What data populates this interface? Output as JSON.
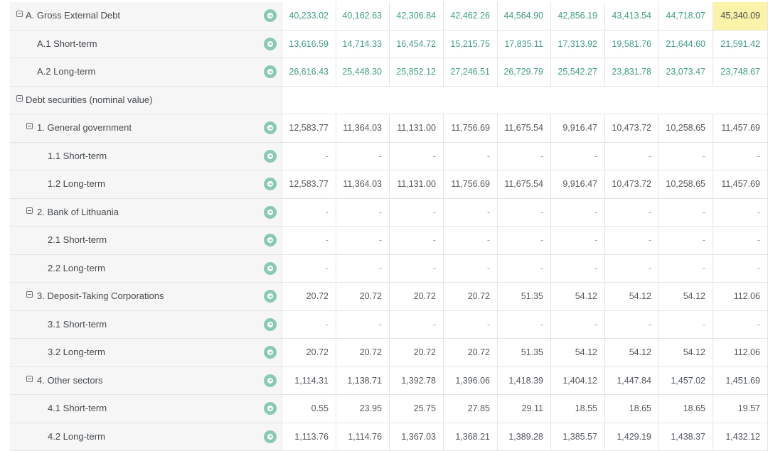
{
  "table": {
    "rows": [
      {
        "label": "A. Gross External Debt",
        "level": 0,
        "toggle": true,
        "info": true,
        "style": "green",
        "highlight_last": true,
        "values": [
          "40,233.02",
          "40,162.63",
          "42,306.84",
          "42,462.26",
          "44,564.90",
          "42,856.19",
          "43,413.54",
          "44,718.07",
          "45,340.09"
        ]
      },
      {
        "label": "A.1 Short-term",
        "level": 2,
        "toggle": false,
        "info": true,
        "style": "green",
        "values": [
          "13,616.59",
          "14,714.33",
          "16,454.72",
          "15,215.75",
          "17,835.11",
          "17,313.92",
          "19,581.76",
          "21,644.60",
          "21,591.42"
        ]
      },
      {
        "label": "A.2 Long-term",
        "level": 2,
        "toggle": false,
        "info": true,
        "style": "green",
        "values": [
          "26,616.43",
          "25,448.30",
          "25,852.12",
          "27,246.51",
          "26,729.79",
          "25,542.27",
          "23,831.78",
          "23,073.47",
          "23,748.67"
        ]
      },
      {
        "label": "Debt securities (nominal value)",
        "level": 0,
        "toggle": true,
        "info": false,
        "values": []
      },
      {
        "label": "1. General government",
        "level": 1,
        "toggle": true,
        "info": true,
        "values": [
          "12,583.77",
          "11,364.03",
          "11,131.00",
          "11,756.69",
          "11,675.54",
          "9,916.47",
          "10,473.72",
          "10,258.65",
          "11,457.69"
        ]
      },
      {
        "label": "1.1 Short-term",
        "level": 3,
        "toggle": false,
        "info": true,
        "values": [
          "-",
          "-",
          "-",
          "-",
          "-",
          "-",
          "-",
          "-",
          "-"
        ]
      },
      {
        "label": "1.2 Long-term",
        "level": 3,
        "toggle": false,
        "info": true,
        "values": [
          "12,583.77",
          "11,364.03",
          "11,131.00",
          "11,756.69",
          "11,675.54",
          "9,916.47",
          "10,473.72",
          "10,258.65",
          "11,457.69"
        ]
      },
      {
        "label": "2. Bank of Lithuania",
        "level": 1,
        "toggle": true,
        "info": true,
        "values": [
          "-",
          "-",
          "-",
          "-",
          "-",
          "-",
          "-",
          "-",
          "-"
        ]
      },
      {
        "label": "2.1 Short-term",
        "level": 3,
        "toggle": false,
        "info": true,
        "values": [
          "-",
          "-",
          "-",
          "-",
          "-",
          "-",
          "-",
          "-",
          "-"
        ]
      },
      {
        "label": "2.2 Long-term",
        "level": 3,
        "toggle": false,
        "info": true,
        "values": [
          "-",
          "-",
          "-",
          "-",
          "-",
          "-",
          "-",
          "-",
          "-"
        ]
      },
      {
        "label": "3. Deposit-Taking Corporations",
        "level": 1,
        "toggle": true,
        "info": true,
        "values": [
          "20.72",
          "20.72",
          "20.72",
          "20.72",
          "51.35",
          "54.12",
          "54.12",
          "54.12",
          "112.06"
        ]
      },
      {
        "label": "3.1 Short-term",
        "level": 3,
        "toggle": false,
        "info": true,
        "values": [
          "-",
          "-",
          "-",
          "-",
          "-",
          "-",
          "-",
          "-",
          "-"
        ]
      },
      {
        "label": "3.2 Long-term",
        "level": 3,
        "toggle": false,
        "info": true,
        "values": [
          "20.72",
          "20.72",
          "20.72",
          "20.72",
          "51.35",
          "54.12",
          "54.12",
          "54.12",
          "112.06"
        ]
      },
      {
        "label": "4. Other sectors",
        "level": 1,
        "toggle": true,
        "info": true,
        "values": [
          "1,114.31",
          "1,138.71",
          "1,392.78",
          "1,396.06",
          "1,418.39",
          "1,404.12",
          "1,447.84",
          "1,457.02",
          "1,451.69"
        ]
      },
      {
        "label": "4.1 Short-term",
        "level": 3,
        "toggle": false,
        "info": true,
        "values": [
          "0.55",
          "23.95",
          "25.75",
          "27.85",
          "29.11",
          "18.55",
          "18.65",
          "18.65",
          "19.57"
        ]
      },
      {
        "label": "4.2 Long-term",
        "level": 3,
        "toggle": false,
        "info": true,
        "values": [
          "1,113.76",
          "1,114.76",
          "1,367.03",
          "1,368.21",
          "1,389.28",
          "1,385.57",
          "1,429.19",
          "1,438.37",
          "1,432.12"
        ]
      }
    ]
  },
  "colors": {
    "green_value": "#43a07e",
    "highlight_bg": "#fbf3a8",
    "info_icon": "#8ac9b4",
    "label_bg": "#f6f6f6",
    "grid_line": "#e4e4e4"
  }
}
